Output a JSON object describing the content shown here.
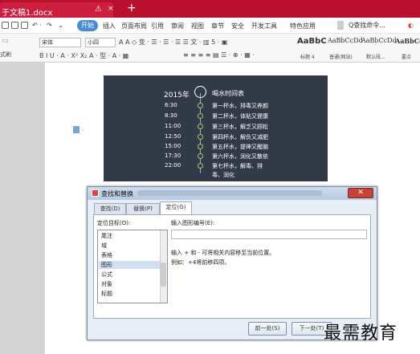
{
  "titlebar": {
    "doc_tab": "于文稿1.docx",
    "warn_icon": "warning-icon",
    "close": "×",
    "add": "+"
  },
  "menubar": {
    "start": "开始",
    "items": [
      "插入",
      "页面布局",
      "引用",
      "审阅",
      "视图",
      "章节",
      "安全",
      "开发工具",
      "特色应用"
    ],
    "search": "Q查找命令..."
  },
  "ribbon": {
    "font_name": "宋体",
    "font_size": "小四",
    "row1_glyphs": "A A ◇ 变 · ☰ · ☰ · ☰ ☰ 文 · ▥ 5 · ▣",
    "row2_glyphs": "B I U · A · X² X₂ A · 型 · A · ▦",
    "row2_right": "≡ ≡ ≡ ≡ ▤ ☰ · ⊕ · ▦ ·",
    "paste_label": "式刷",
    "styles": [
      {
        "preview": "AaBbC",
        "label": "标题 4"
      },
      {
        "preview": "AaBbCcDd",
        "label": "普通(网站)"
      },
      {
        "preview": "AaBbCcDd",
        "label": "默认段..."
      },
      {
        "preview": "AaBbCcD",
        "label": "要点"
      }
    ]
  },
  "timeline": {
    "year": "2015年",
    "title": "喝水时间表",
    "rows": [
      {
        "time": "6:30",
        "text": "第一杯水，排毒又养颜"
      },
      {
        "time": "8:30",
        "text": "第二杯水，体貼又健康"
      },
      {
        "time": "11:00",
        "text": "第三杯水，解乏又顾松"
      },
      {
        "time": "12:50",
        "text": "第四杯水，解负又减肥"
      },
      {
        "time": "15:00",
        "text": "第五杯水，提神又醒脑"
      },
      {
        "time": "17:30",
        "text": "第六杯水，润化又散依"
      },
      {
        "time": "22:00",
        "text": "第七杯水，解毒、排"
      }
    ],
    "continued": "毒、润化"
  },
  "doc": {
    "dot": "·"
  },
  "dialog": {
    "title": "查找和替换",
    "close": "✕",
    "tabs": [
      "查找(D)",
      "替换(P)",
      "定位(G)"
    ],
    "target_label": "定位目标(O):",
    "list": [
      "尾注",
      "域",
      "表格",
      "图形",
      "公式",
      "对象",
      "标题"
    ],
    "selected_index": 3,
    "input_label": "输入图形编号(E):",
    "hint1": "输入 + 和 - 可将相关内容移至当前位置。",
    "hint2": "例如：+4将前移四项。",
    "prev_button": "前一处(S)",
    "next_button": "下一处(T)"
  },
  "watermark": "最需教育"
}
